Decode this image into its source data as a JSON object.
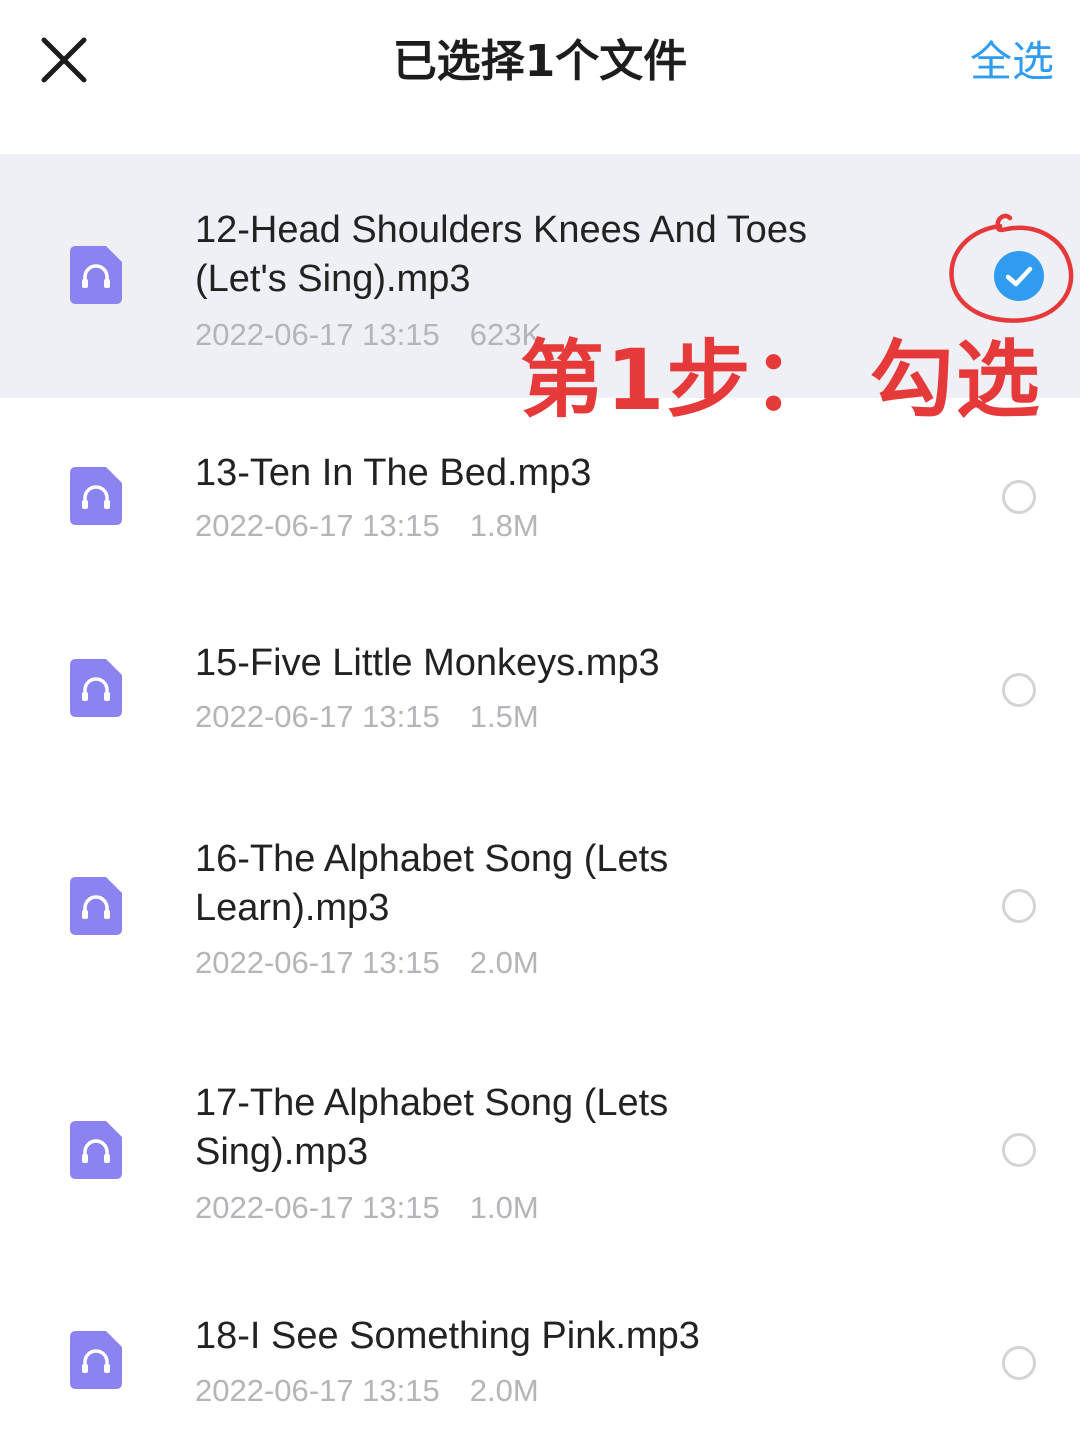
{
  "header": {
    "title": "已选择1个文件",
    "select_all_label": "全选",
    "close_icon": "close-icon"
  },
  "files": [
    {
      "name_line1": "12-Head Shoulders Knees And Toes",
      "name_line2": "(Let's Sing).mp3",
      "date": "2022-06-17 13:15",
      "size": "623K",
      "selected": true
    },
    {
      "name_line1": "13-Ten In The Bed.mp3",
      "name_line2": "",
      "date": "2022-06-17 13:15",
      "size": "1.8M",
      "selected": false
    },
    {
      "name_line1": "15-Five Little Monkeys.mp3",
      "name_line2": "",
      "date": "2022-06-17 13:15",
      "size": "1.5M",
      "selected": false
    },
    {
      "name_line1": "16-The Alphabet Song (Lets",
      "name_line2": "Learn).mp3",
      "date": "2022-06-17 13:15",
      "size": "2.0M",
      "selected": false
    },
    {
      "name_line1": "17-The Alphabet Song (Lets",
      "name_line2": "Sing).mp3",
      "date": "2022-06-17 13:15",
      "size": "1.0M",
      "selected": false
    },
    {
      "name_line1": "18-I See Something Pink.mp3",
      "name_line2": "",
      "date": "2022-06-17 13:15",
      "size": "2.0M",
      "selected": false
    }
  ],
  "annotation": {
    "text": "第1步：  勾选",
    "color": "#e63a3a"
  },
  "colors": {
    "accent": "#2f9cf0",
    "icon": "#8b84f0",
    "selected_row_bg": "#eef0f5"
  }
}
